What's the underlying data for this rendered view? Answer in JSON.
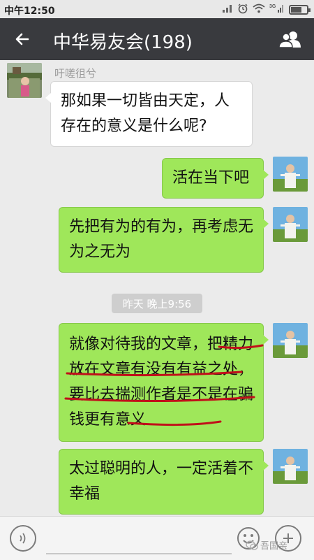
{
  "status_bar": {
    "time": "中午12:50",
    "battery_level": 0.7,
    "icons": [
      "signal-icon",
      "alarm-icon",
      "wifi-icon",
      "cellular-icon",
      "battery-icon"
    ]
  },
  "header": {
    "title": "中华易友会(198)",
    "background": "#393a3e"
  },
  "messages": [
    {
      "side": "left",
      "sender": "吁嗟徂兮",
      "text": "那如果一切皆由天定，人存在的意义是什么呢?"
    },
    {
      "side": "right",
      "text": "活在当下吧"
    },
    {
      "side": "right",
      "text": "先把有为的有为，再考虑无为之无为"
    },
    {
      "side": "right",
      "text": "就像对待我的文章，把精力放在文章有没有有益之处，要比去揣测作者是不是在骗钱更有意义"
    },
    {
      "side": "right",
      "text": "太过聪明的人，一定活着不幸福"
    }
  ],
  "timestamp": "昨天 晚上9:56",
  "input_bar": {
    "placeholder": ""
  },
  "watermark": "吾国亲",
  "colors": {
    "bubble_right": "#9fe75a",
    "bubble_left": "#ffffff",
    "chat_background": "#ebebeb",
    "annotation_red": "#c0101a"
  }
}
